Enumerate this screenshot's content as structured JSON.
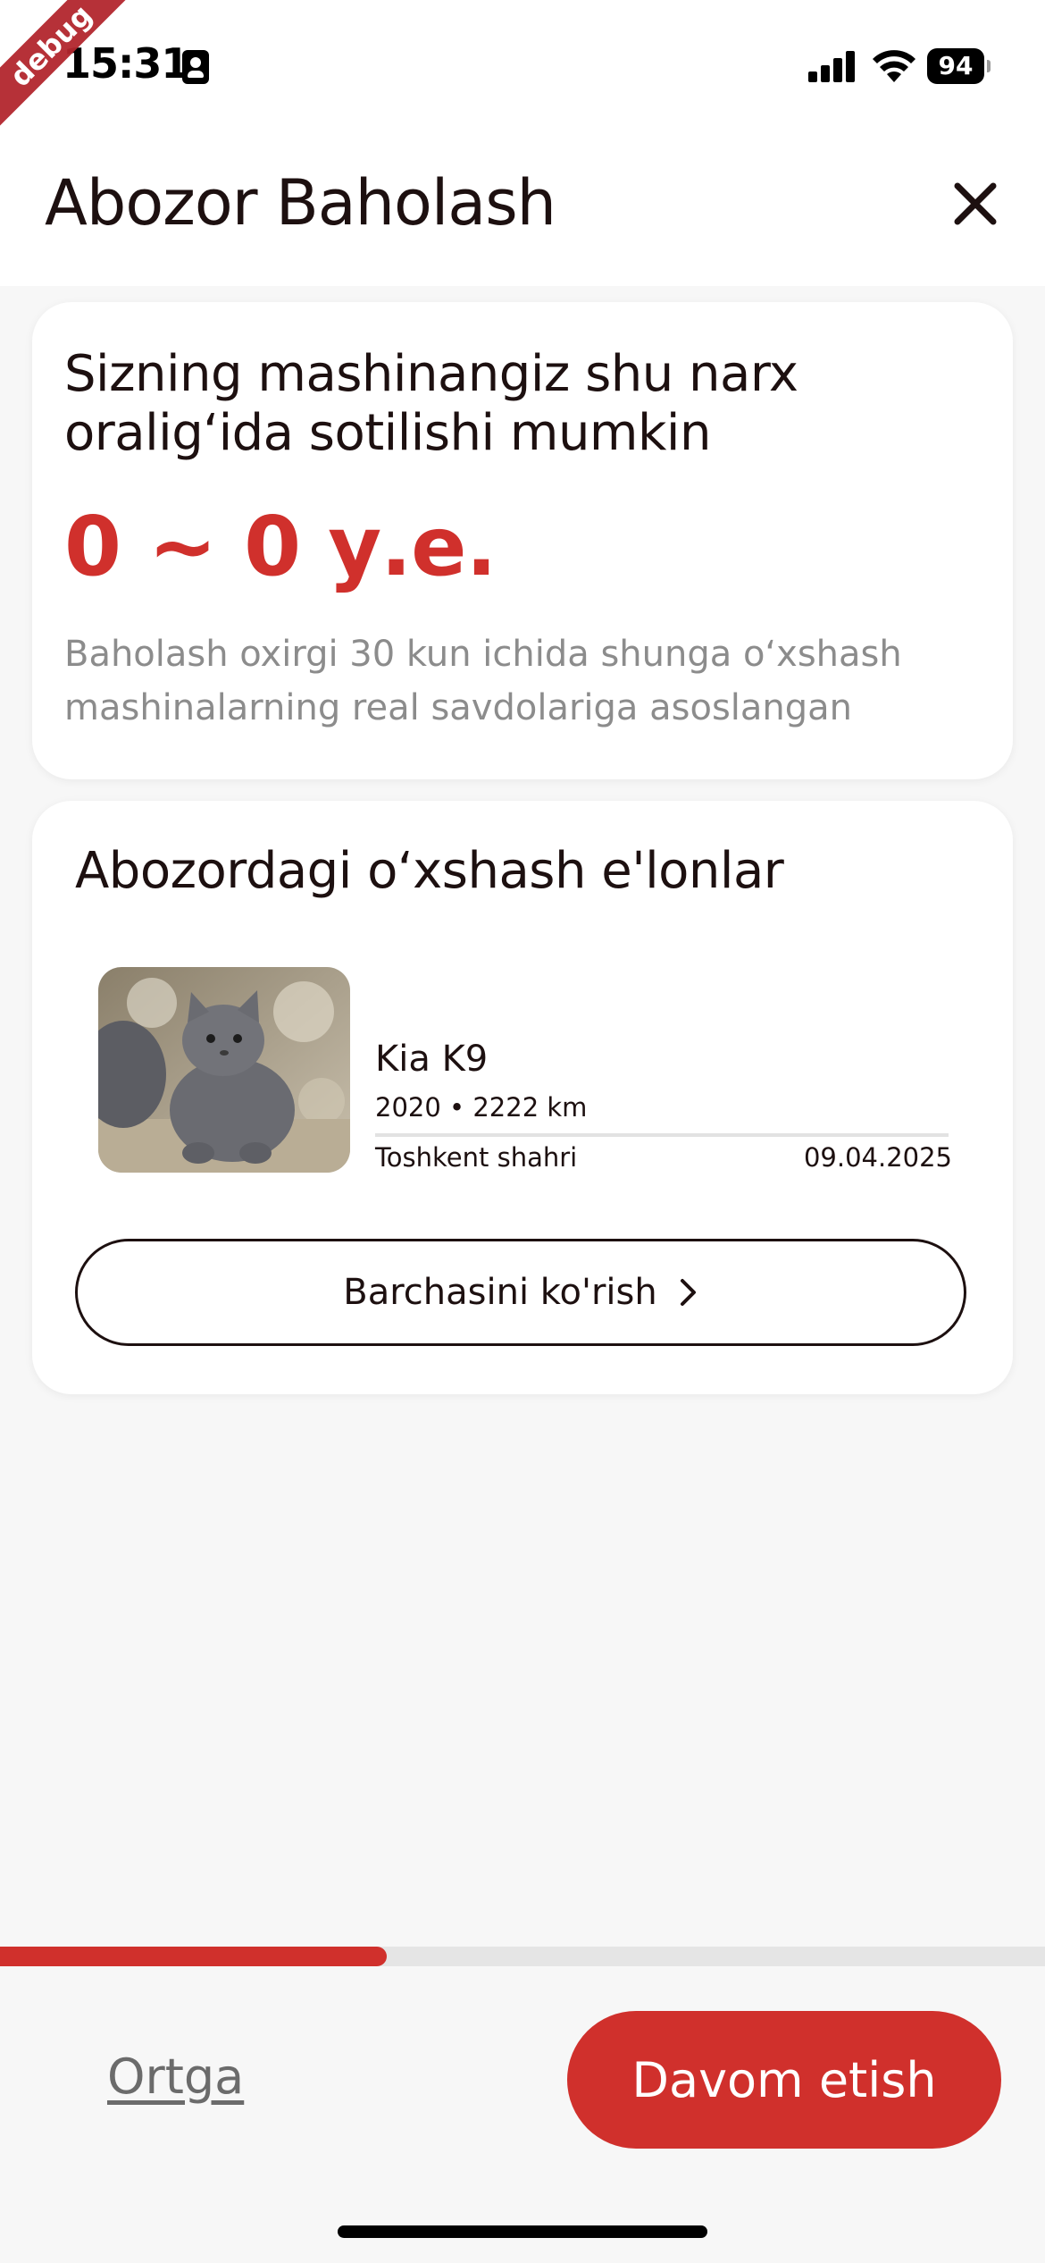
{
  "status_bar": {
    "time": "15:31",
    "battery": "94"
  },
  "debug_banner": "debug",
  "header": {
    "title": "Abozor Baholash"
  },
  "estimate": {
    "heading": "Sizning mashinangiz shu narx oralig‘ida sotilishi mumkin",
    "price": "0 ~ 0 у.е.",
    "note": "Baholash oxirgi 30 kun ichida shunga o‘xshash mashinalarning real savdolariga asoslangan"
  },
  "similar": {
    "title": "Abozordagi o‘xshash e'lonlar",
    "listings": [
      {
        "name": "Kia K9",
        "year": "2020",
        "mileage": "2222 km",
        "city": "Toshkent shahri",
        "date": "09.04.2025"
      }
    ],
    "see_all_label": "Barchasini ko'rish"
  },
  "progress": {
    "fraction": 0.37
  },
  "footer": {
    "back_label": "Ortga",
    "continue_label": "Davom etish"
  },
  "colors": {
    "accent": "#d0302c",
    "text": "#1d1010",
    "muted": "#8c8c8c"
  },
  "icons": {
    "close": "close-icon",
    "chevron": "chevron-right-icon"
  }
}
